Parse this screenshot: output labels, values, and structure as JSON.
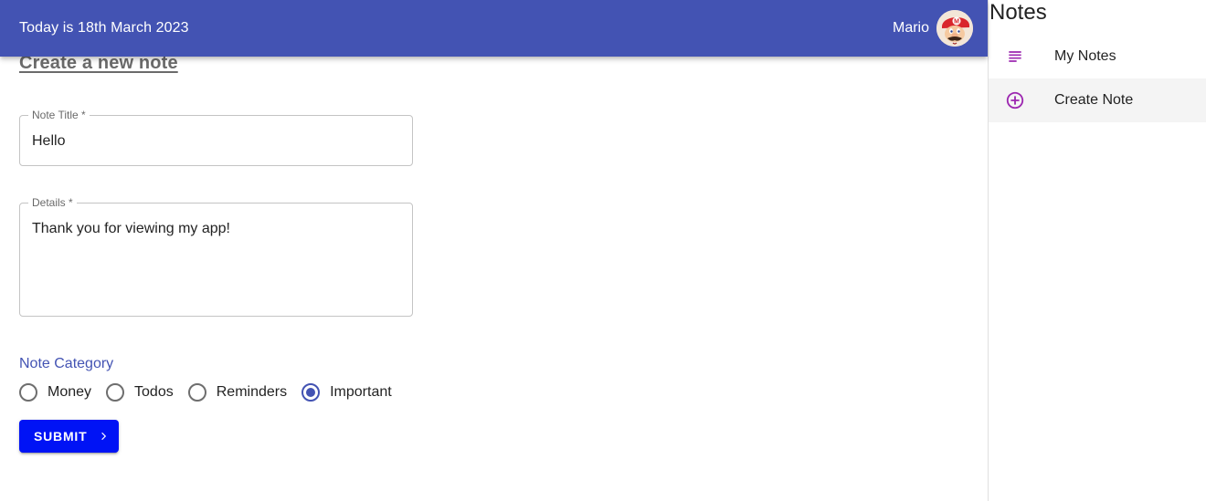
{
  "appbar": {
    "date_text": "Today is 18th March 2023",
    "user_name": "Mario",
    "background_color": "#4353b3"
  },
  "page": {
    "heading": "Create a new note"
  },
  "form": {
    "title_field": {
      "label": "Note Title *",
      "value": "Hello"
    },
    "details_field": {
      "label": "Details *",
      "value": "Thank you for viewing my app!"
    },
    "category": {
      "label": "Note Category",
      "options": [
        {
          "label": "Money",
          "checked": false
        },
        {
          "label": "Todos",
          "checked": false
        },
        {
          "label": "Reminders",
          "checked": false
        },
        {
          "label": "Important",
          "checked": true
        }
      ],
      "accent_color": "#4353b3"
    },
    "submit": {
      "label": "SUBMIT",
      "icon": "chevron-right-icon",
      "color": "#0013f5"
    }
  },
  "drawer": {
    "title": "Notes",
    "items": [
      {
        "label": "My Notes",
        "icon": "subject-icon",
        "active": false
      },
      {
        "label": "Create Note",
        "icon": "add-circle-outline-icon",
        "active": true
      }
    ],
    "icon_color": "#9c27b0"
  }
}
